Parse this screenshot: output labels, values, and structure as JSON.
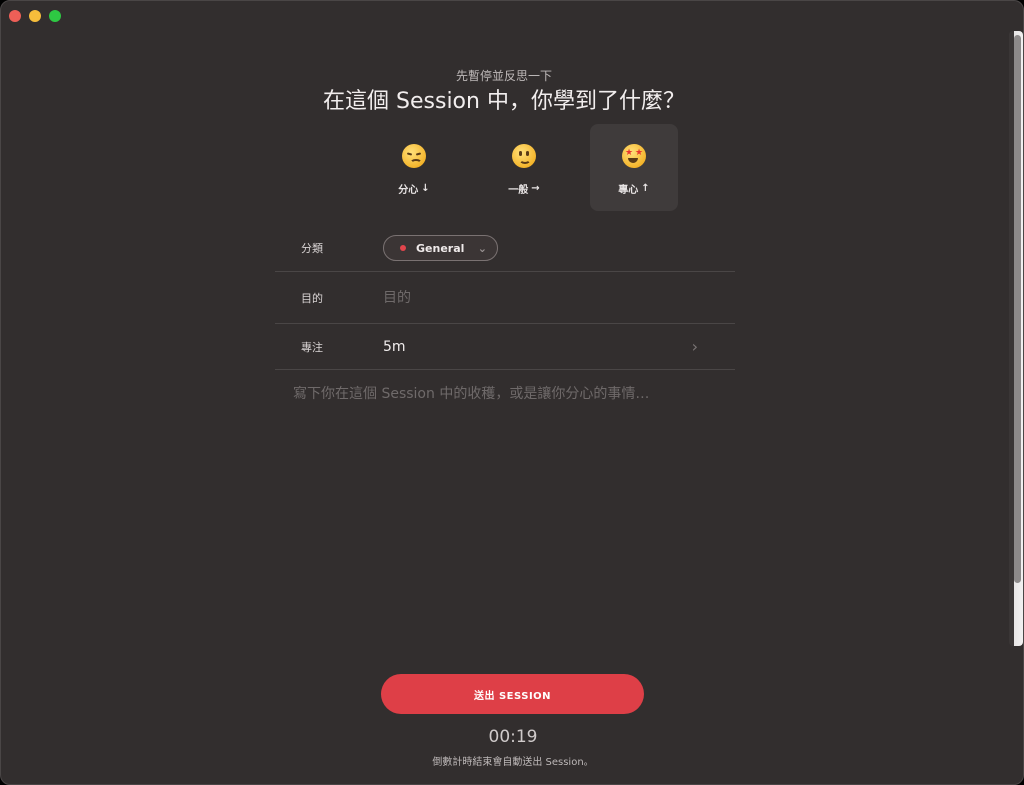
{
  "header": {
    "subtitle": "先暫停並反思一下",
    "title": "在這個 Session 中，你學到了什麼？"
  },
  "moods": [
    {
      "label": "分心",
      "arrow": "↓",
      "icon": "pensive-face-icon"
    },
    {
      "label": "一般",
      "arrow": "→",
      "icon": "slightly-smiling-face-icon"
    },
    {
      "label": "專心",
      "arrow": "↑",
      "icon": "star-struck-face-icon",
      "selected": true
    }
  ],
  "form": {
    "category_label": "分類",
    "category_value": "General",
    "category_color": "#e2454c",
    "goal_label": "目的",
    "goal_placeholder": "目的",
    "focus_label": "專注",
    "focus_value": "5m"
  },
  "notes_placeholder": "寫下你在這個 Session 中的收穫，或是讓你分心的事情…",
  "submit_label": "送出 SESSION",
  "timer": "00:19",
  "footnote": "倒數計時結束會自動送出 Session。",
  "colors": {
    "accent": "#de3f47",
    "background": "#322e2e"
  }
}
